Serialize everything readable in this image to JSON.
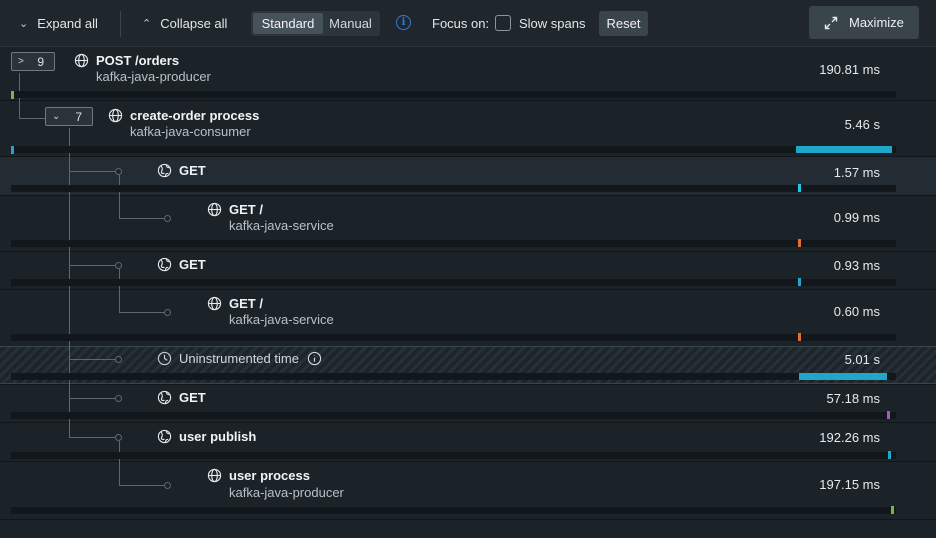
{
  "toolbar": {
    "expand_all": "Expand all",
    "collapse_all": "Collapse all",
    "view_standard": "Standard",
    "view_manual": "Manual",
    "focus_on": "Focus on:",
    "slow_spans": "Slow spans",
    "reset": "Reset",
    "maximize": "Maximize"
  },
  "spans": [
    {
      "name": "POST /orders",
      "service": "kafka-java-producer",
      "duration": "190.81 ms",
      "children_count": "9"
    },
    {
      "name": "create-order process",
      "service": "kafka-java-consumer",
      "duration": "5.46 s",
      "children_count": "7"
    },
    {
      "name": "GET",
      "service": "",
      "duration": "1.57 ms"
    },
    {
      "name": "GET /",
      "service": "kafka-java-service",
      "duration": "0.99 ms"
    },
    {
      "name": "GET",
      "service": "",
      "duration": "0.93 ms"
    },
    {
      "name": "GET /",
      "service": "kafka-java-service",
      "duration": "0.60 ms"
    },
    {
      "name": "Uninstrumented time",
      "service": "",
      "duration": "5.01 s"
    },
    {
      "name": "GET",
      "service": "",
      "duration": "57.18 ms"
    },
    {
      "name": "user publish",
      "service": "",
      "duration": "192.26 ms"
    },
    {
      "name": "user process",
      "service": "kafka-java-producer",
      "duration": "197.15 ms"
    }
  ],
  "colors": {
    "accent_blue": "#2f7de1",
    "bar_cyan": "#1fa6c9",
    "mark_green": "#7cb342",
    "mark_orange": "#e0703a",
    "mark_purple": "#a855c9"
  },
  "icons": {
    "global_span": "globe-icon",
    "external_span": "globe-crossed-icon",
    "uninstrumented": "clock-icon"
  }
}
